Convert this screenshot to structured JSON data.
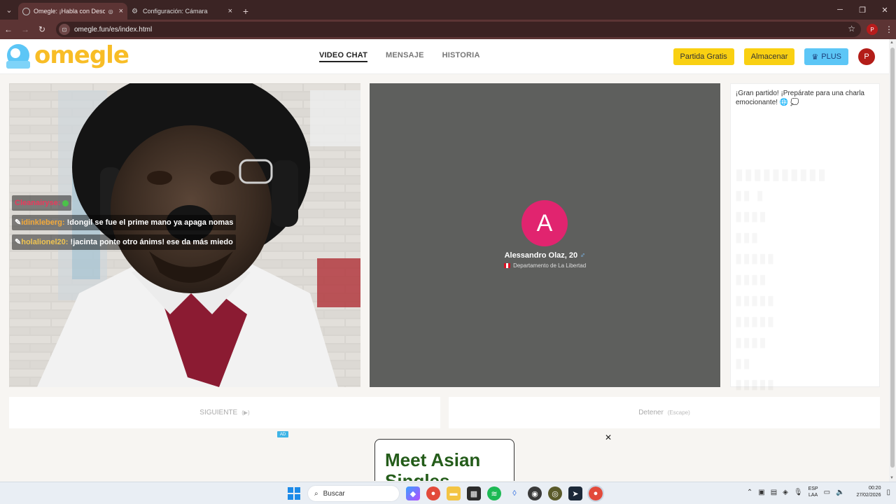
{
  "browser": {
    "tabs": [
      {
        "title": "Omegle: ¡Habla con Descon",
        "active": true
      },
      {
        "title": "Configuración: Cámara",
        "active": false
      }
    ],
    "url": "omegle.fun/es/index.html",
    "profile_initial": "P"
  },
  "header": {
    "logo": "omegle",
    "nav": [
      {
        "label": "VIDEO CHAT",
        "active": true
      },
      {
        "label": "MENSAJE",
        "active": false
      },
      {
        "label": "HISTORIA",
        "active": false
      }
    ],
    "buttons": {
      "free_match": "Partida Gratis",
      "store": "Almacenar",
      "plus": "PLUS"
    },
    "user_initial": "P"
  },
  "chat_overlay": [
    {
      "user": "Cleanairyse:",
      "text": ""
    },
    {
      "user": "idinkleberg:",
      "text": "!dongil se fue el prime mano ya apaga nomas"
    },
    {
      "user": "holalionel20:",
      "text": "!jacinta ponte otro ánims! ese da más miedo"
    }
  ],
  "stranger": {
    "avatar_initial": "A",
    "name": "Alessandro Olaz, 20",
    "location": "Departamento de La Libertad"
  },
  "side_panel": {
    "message": "¡Gran partido! ¡Prepárate para una charla emocionante! 🌐 💭"
  },
  "controls": {
    "next_label": "SIGUIENTE",
    "next_hint": "(▶)",
    "stop_label": "Detener",
    "stop_hint": "(Escape)"
  },
  "ad": {
    "tag": "AD",
    "text_line1": "Meet Asian",
    "text_line2": "Singles"
  },
  "taskbar": {
    "search_placeholder": "Buscar",
    "lang": "ESP",
    "lang_sub": "LAA",
    "time": "00:20",
    "date": "27/02/2026"
  },
  "colors": {
    "omegle_yellow": "#f8bd26",
    "omegle_blue": "#5cc6f6",
    "stranger_avatar": "#e1246f",
    "chrome_dark": "#3b2424"
  }
}
